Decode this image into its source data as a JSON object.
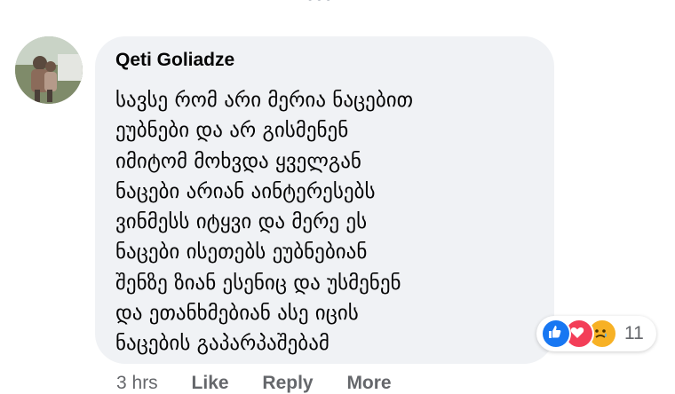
{
  "comment": {
    "author": "Qeti Goliadze",
    "lines": [
      "სავსე რომ არი მერია ნაცებით",
      "ეუბნები და არ გისმენენ",
      "იმიტომ მოხვდა ყველგან",
      "ნაცები არიან აინტერესებს",
      "ვინმესს იტყვი და მერე ეს",
      "ნაცები ისეთებს ეუბნებიან",
      "შენზე ზიან ესენიც და უსმენენ",
      "და ეთანხმებიან ასე იცის",
      "ნაცების გაპარპაშებამ"
    ]
  },
  "reactions": {
    "icons": [
      "like-icon",
      "love-icon",
      "sad-icon"
    ],
    "count": "11"
  },
  "actions": {
    "time": "3 hrs",
    "like": "Like",
    "reply": "Reply",
    "more": "More"
  },
  "colors": {
    "bubble": "#f0f2f5",
    "secondary_text": "#65676b",
    "like_blue": "#1877f2",
    "love_red": "#f33e58",
    "sad_yellow": "#f7b125"
  }
}
